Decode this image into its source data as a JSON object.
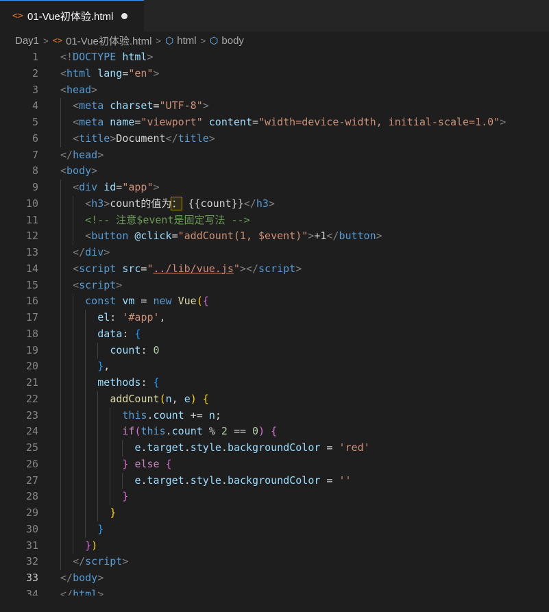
{
  "tab": {
    "icon": "html-file-icon",
    "title": "01-Vue初体验.html",
    "modified": true
  },
  "breadcrumb": [
    "Day1",
    "01-Vue初体验.html",
    "html",
    "body"
  ],
  "editor": {
    "current_line": 33,
    "lines": [
      {
        "n": "1",
        "indent": 0,
        "tokens": [
          [
            "p",
            "<!"
          ],
          [
            "t",
            "DOCTYPE "
          ],
          [
            "a",
            "html"
          ],
          [
            "p",
            ">"
          ]
        ]
      },
      {
        "n": "2",
        "indent": 0,
        "tokens": [
          [
            "p",
            "<"
          ],
          [
            "t",
            "html"
          ],
          [
            "a",
            " lang"
          ],
          [
            "x",
            "="
          ],
          [
            "s",
            "\"en\""
          ],
          [
            "p",
            ">"
          ]
        ]
      },
      {
        "n": "3",
        "indent": 0,
        "tokens": [
          [
            "p",
            "<"
          ],
          [
            "t",
            "head"
          ],
          [
            "p",
            ">"
          ]
        ]
      },
      {
        "n": "4",
        "indent": 1,
        "tokens": [
          [
            "p",
            "<"
          ],
          [
            "t",
            "meta"
          ],
          [
            "a",
            " charset"
          ],
          [
            "x",
            "="
          ],
          [
            "s",
            "\"UTF-8\""
          ],
          [
            "p",
            ">"
          ]
        ]
      },
      {
        "n": "5",
        "indent": 1,
        "tokens": [
          [
            "p",
            "<"
          ],
          [
            "t",
            "meta"
          ],
          [
            "a",
            " name"
          ],
          [
            "x",
            "="
          ],
          [
            "s",
            "\"viewport\""
          ],
          [
            "a",
            " content"
          ],
          [
            "x",
            "="
          ],
          [
            "s",
            "\"width=device-width, initial-scale=1.0\""
          ],
          [
            "p",
            ">"
          ]
        ]
      },
      {
        "n": "6",
        "indent": 1,
        "tokens": [
          [
            "p",
            "<"
          ],
          [
            "t",
            "title"
          ],
          [
            "p",
            ">"
          ],
          [
            "x",
            "Document"
          ],
          [
            "p",
            "</"
          ],
          [
            "t",
            "title"
          ],
          [
            "p",
            ">"
          ]
        ]
      },
      {
        "n": "7",
        "indent": 0,
        "tokens": [
          [
            "p",
            "</"
          ],
          [
            "t",
            "head"
          ],
          [
            "p",
            ">"
          ]
        ]
      },
      {
        "n": "8",
        "indent": 0,
        "tokens": [
          [
            "p",
            "<"
          ],
          [
            "t",
            "body"
          ],
          [
            "p",
            ">"
          ]
        ]
      },
      {
        "n": "9",
        "indent": 1,
        "tokens": [
          [
            "p",
            "<"
          ],
          [
            "t",
            "div"
          ],
          [
            "a",
            " id"
          ],
          [
            "x",
            "="
          ],
          [
            "s",
            "\"app\""
          ],
          [
            "p",
            ">"
          ]
        ]
      },
      {
        "n": "10",
        "indent": 2,
        "tokens": [
          [
            "p",
            "<"
          ],
          [
            "t",
            "h3"
          ],
          [
            "p",
            ">"
          ],
          [
            "x",
            "count的值为"
          ],
          [
            "hl",
            "："
          ],
          [
            "x",
            " {{count}}"
          ],
          [
            "p",
            "</"
          ],
          [
            "t",
            "h3"
          ],
          [
            "p",
            ">"
          ]
        ]
      },
      {
        "n": "11",
        "indent": 2,
        "tokens": [
          [
            "c",
            "<!-- 注意$event是固定写法 -->"
          ]
        ]
      },
      {
        "n": "12",
        "indent": 2,
        "tokens": [
          [
            "p",
            "<"
          ],
          [
            "t",
            "button"
          ],
          [
            "a",
            " @click"
          ],
          [
            "x",
            "="
          ],
          [
            "s",
            "\"addCount(1, $event)\""
          ],
          [
            "p",
            ">"
          ],
          [
            "x",
            "+1"
          ],
          [
            "p",
            "</"
          ],
          [
            "t",
            "button"
          ],
          [
            "p",
            ">"
          ]
        ]
      },
      {
        "n": "13",
        "indent": 1,
        "tokens": [
          [
            "p",
            "</"
          ],
          [
            "t",
            "div"
          ],
          [
            "p",
            ">"
          ]
        ]
      },
      {
        "n": "14",
        "indent": 1,
        "tokens": [
          [
            "p",
            "<"
          ],
          [
            "t",
            "script"
          ],
          [
            "a",
            " src"
          ],
          [
            "x",
            "="
          ],
          [
            "s",
            "\""
          ],
          [
            "u",
            "../lib/vue.js"
          ],
          [
            "s",
            "\""
          ],
          [
            "p",
            "></"
          ],
          [
            "t",
            "script"
          ],
          [
            "p",
            ">"
          ]
        ]
      },
      {
        "n": "15",
        "indent": 1,
        "tokens": [
          [
            "p",
            "<"
          ],
          [
            "t",
            "script"
          ],
          [
            "p",
            ">"
          ]
        ]
      },
      {
        "n": "16",
        "indent": 2,
        "tokens": [
          [
            "k",
            "const "
          ],
          [
            "v",
            "vm"
          ],
          [
            "x",
            " = "
          ],
          [
            "k",
            "new "
          ],
          [
            "f",
            "Vue"
          ],
          [
            "b1",
            "("
          ],
          [
            "b2",
            "{"
          ]
        ]
      },
      {
        "n": "17",
        "indent": 3,
        "tokens": [
          [
            "v",
            "el"
          ],
          [
            "x",
            ": "
          ],
          [
            "s",
            "'#app'"
          ],
          [
            "x",
            ","
          ]
        ]
      },
      {
        "n": "18",
        "indent": 3,
        "tokens": [
          [
            "v",
            "data"
          ],
          [
            "x",
            ": "
          ],
          [
            "b3",
            "{"
          ]
        ]
      },
      {
        "n": "19",
        "indent": 4,
        "tokens": [
          [
            "v",
            "count"
          ],
          [
            "x",
            ": "
          ],
          [
            "n",
            "0"
          ]
        ]
      },
      {
        "n": "20",
        "indent": 3,
        "tokens": [
          [
            "b3",
            "}"
          ],
          [
            "x",
            ","
          ]
        ]
      },
      {
        "n": "21",
        "indent": 3,
        "tokens": [
          [
            "v",
            "methods"
          ],
          [
            "x",
            ": "
          ],
          [
            "b3",
            "{"
          ]
        ]
      },
      {
        "n": "22",
        "indent": 4,
        "tokens": [
          [
            "f",
            "addCount"
          ],
          [
            "b1",
            "("
          ],
          [
            "v",
            "n"
          ],
          [
            "x",
            ", "
          ],
          [
            "v",
            "e"
          ],
          [
            "b1",
            ")"
          ],
          [
            "x",
            " "
          ],
          [
            "b1",
            "{"
          ]
        ]
      },
      {
        "n": "23",
        "indent": 5,
        "tokens": [
          [
            "k",
            "this"
          ],
          [
            "x",
            "."
          ],
          [
            "v",
            "count"
          ],
          [
            "x",
            " += "
          ],
          [
            "v",
            "n"
          ],
          [
            "x",
            ";"
          ]
        ]
      },
      {
        "n": "24",
        "indent": 5,
        "tokens": [
          [
            "ck",
            "if"
          ],
          [
            "b2",
            "("
          ],
          [
            "k",
            "this"
          ],
          [
            "x",
            "."
          ],
          [
            "v",
            "count"
          ],
          [
            "x",
            " % "
          ],
          [
            "n",
            "2"
          ],
          [
            "x",
            " == "
          ],
          [
            "n",
            "0"
          ],
          [
            "b2",
            ")"
          ],
          [
            "x",
            " "
          ],
          [
            "b2",
            "{"
          ]
        ]
      },
      {
        "n": "25",
        "indent": 6,
        "tokens": [
          [
            "v",
            "e"
          ],
          [
            "x",
            "."
          ],
          [
            "v",
            "target"
          ],
          [
            "x",
            "."
          ],
          [
            "v",
            "style"
          ],
          [
            "x",
            "."
          ],
          [
            "v",
            "backgroundColor"
          ],
          [
            "x",
            " = "
          ],
          [
            "s",
            "'red'"
          ]
        ]
      },
      {
        "n": "26",
        "indent": 5,
        "tokens": [
          [
            "b2",
            "}"
          ],
          [
            "x",
            " "
          ],
          [
            "ck",
            "else"
          ],
          [
            "x",
            " "
          ],
          [
            "b2",
            "{"
          ]
        ]
      },
      {
        "n": "27",
        "indent": 6,
        "tokens": [
          [
            "v",
            "e"
          ],
          [
            "x",
            "."
          ],
          [
            "v",
            "target"
          ],
          [
            "x",
            "."
          ],
          [
            "v",
            "style"
          ],
          [
            "x",
            "."
          ],
          [
            "v",
            "backgroundColor"
          ],
          [
            "x",
            " = "
          ],
          [
            "s",
            "''"
          ]
        ]
      },
      {
        "n": "28",
        "indent": 5,
        "tokens": [
          [
            "b2",
            "}"
          ]
        ]
      },
      {
        "n": "29",
        "indent": 4,
        "tokens": [
          [
            "b1",
            "}"
          ]
        ]
      },
      {
        "n": "30",
        "indent": 3,
        "tokens": [
          [
            "b3",
            "}"
          ]
        ]
      },
      {
        "n": "31",
        "indent": 2,
        "tokens": [
          [
            "b2",
            "}"
          ],
          [
            "b1",
            ")"
          ]
        ]
      },
      {
        "n": "32",
        "indent": 1,
        "tokens": [
          [
            "p",
            "</"
          ],
          [
            "t",
            "script"
          ],
          [
            "p",
            ">"
          ]
        ]
      },
      {
        "n": "33",
        "indent": 0,
        "tokens": [
          [
            "p",
            "</"
          ],
          [
            "t",
            "body"
          ],
          [
            "p",
            ">"
          ]
        ]
      },
      {
        "n": "34",
        "indent": 0,
        "tokens": [
          [
            "p",
            "</"
          ],
          [
            "t",
            "html"
          ],
          [
            "p",
            ">"
          ]
        ]
      }
    ]
  }
}
